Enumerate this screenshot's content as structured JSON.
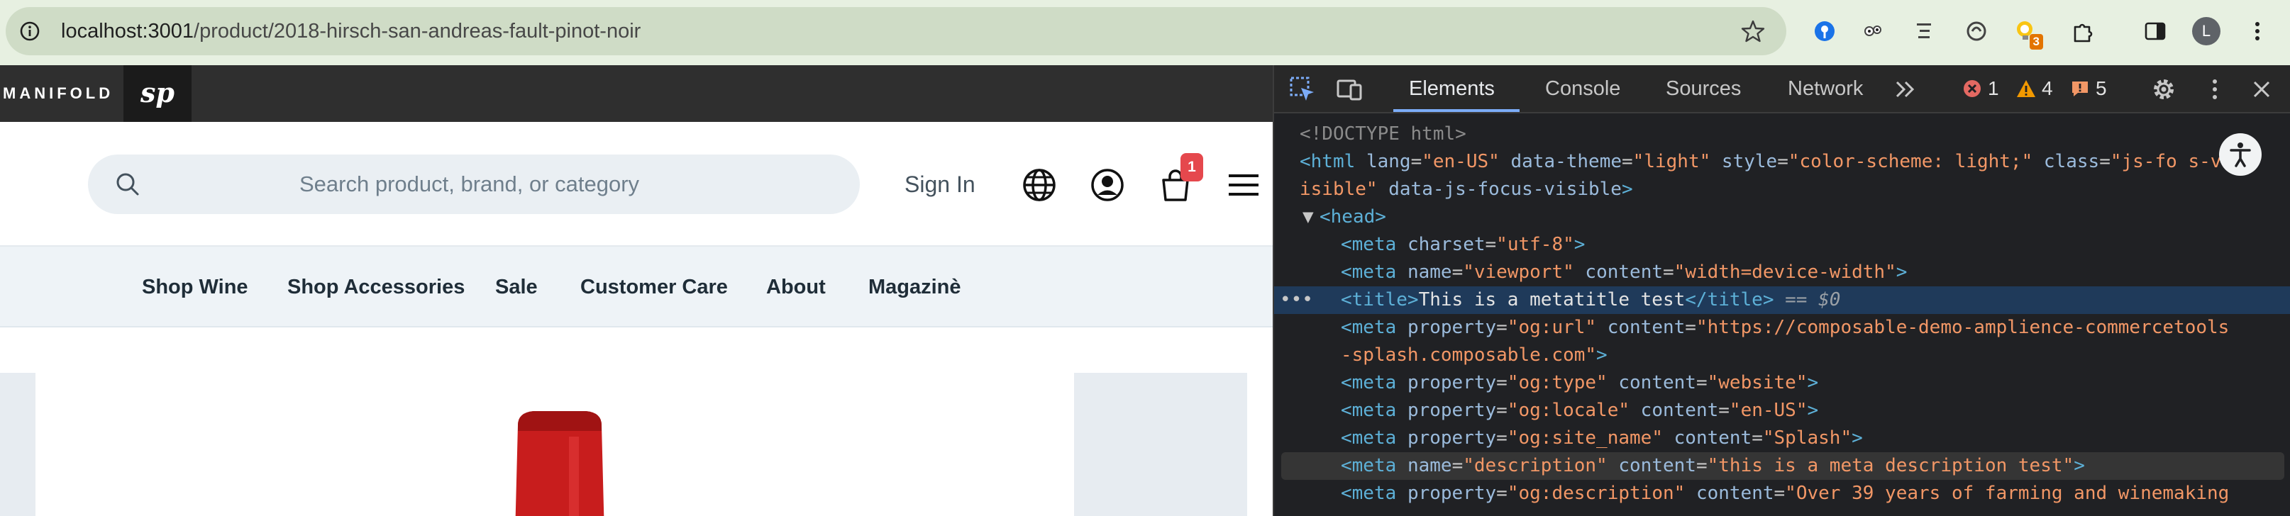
{
  "browser": {
    "url_host": "localhost:3001",
    "url_path": "/product/2018-hirsch-san-andreas-fault-pinot-noir",
    "extensions_badge": "3",
    "profile_initial": "L"
  },
  "site": {
    "brand": "MANIFOLD",
    "logo_text": "sp",
    "search_placeholder": "Search product, brand, or category",
    "sign_in": "Sign In",
    "cart_count": "1",
    "nav": [
      "Shop Wine",
      "Shop Accessories",
      "Sale",
      "Customer Care",
      "About",
      "Magazinè"
    ]
  },
  "devtools": {
    "tabs": [
      "Elements",
      "Console",
      "Sources",
      "Network"
    ],
    "active_tab": "Elements",
    "errors": "1",
    "warnings": "4",
    "issues": "5",
    "dom": {
      "doctype": "<!DOCTYPE html>",
      "html_lang": "en-US",
      "html_theme": "light",
      "html_style": "color-scheme: light;",
      "html_class_a": "js-fo",
      "html_class_b": "s-v",
      "html_class_cont": "isible",
      "html_attr_end": "data-js-focus-visible",
      "meta_charset": "utf-8",
      "meta_viewport_name": "viewport",
      "meta_viewport_content": "width=device-width",
      "title_text": "This is a metatitle test",
      "selected_marker": "== $0",
      "og_url_content_a": "https://composable-demo-amplience-commercetools",
      "og_url_content_b": "-splash.composable.com",
      "og_type": "website",
      "og_locale": "en-US",
      "og_site_name": "Splash",
      "description": "this is a meta description test",
      "og_description": "Over 39 years of farming and winemaking"
    }
  },
  "colors": {
    "chrome_bg": "#e7f0e1",
    "topbar": "#2f2f2f",
    "cart_badge": "#e5484d",
    "devtools_bg": "#202124",
    "selected_row": "#1f3a5a"
  }
}
